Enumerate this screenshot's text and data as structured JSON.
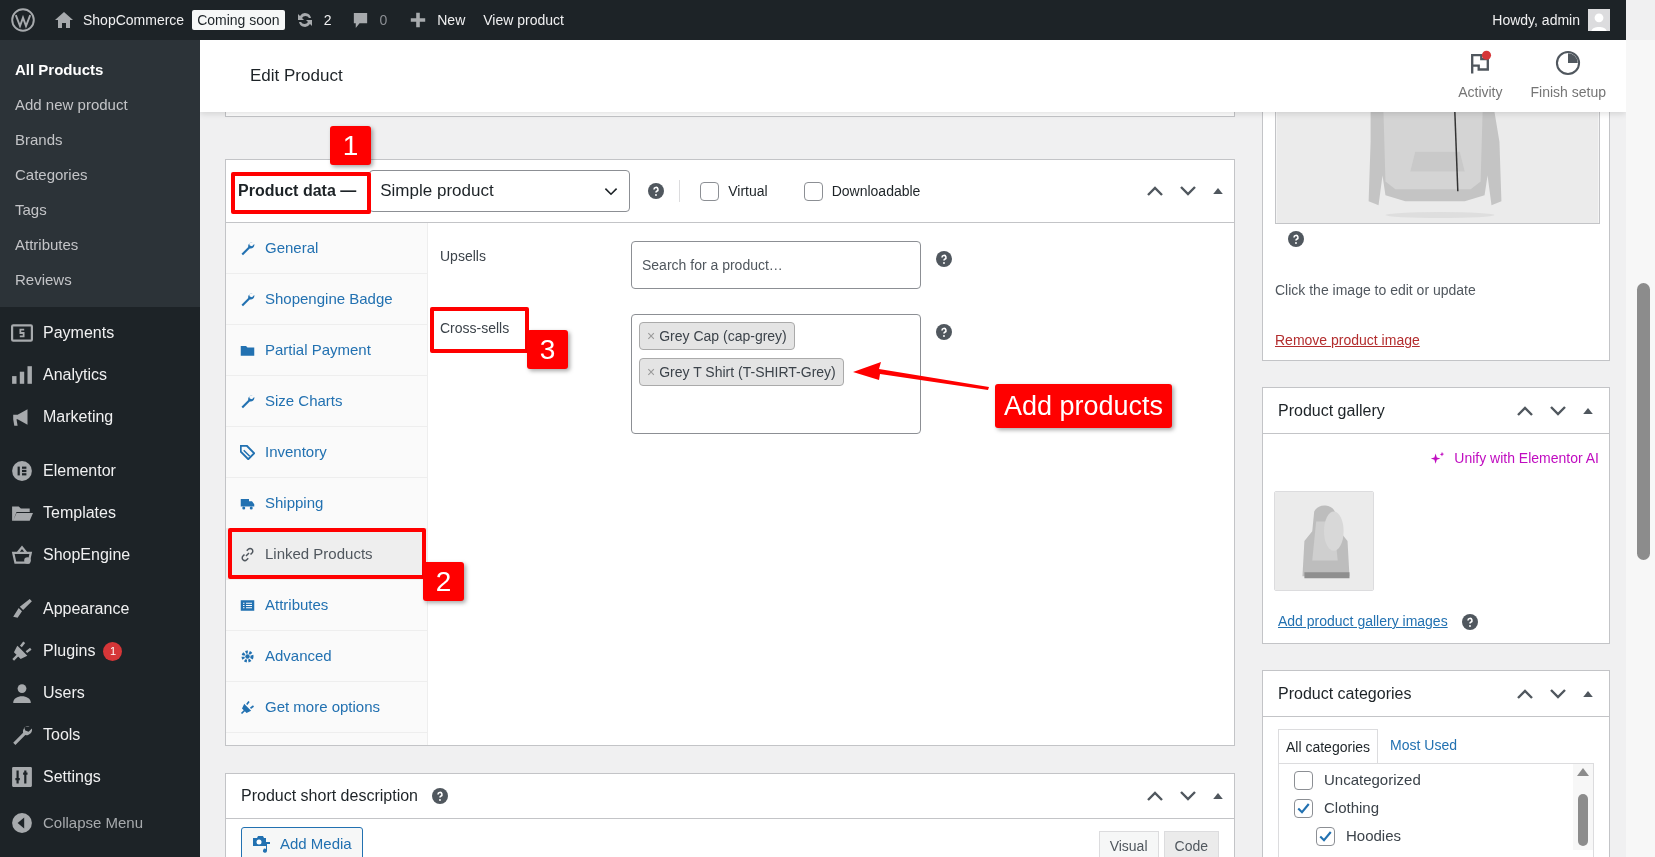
{
  "admin_bar": {
    "site_name": "ShopCommerce",
    "site_status": "Coming soon",
    "updates_count": "2",
    "comments_count": "0",
    "new_label": "New",
    "view_label": "View product",
    "greeting": "Howdy, admin"
  },
  "sidebar": {
    "submenu": [
      {
        "label": "All Products",
        "selected": true
      },
      {
        "label": "Add new product",
        "selected": false
      },
      {
        "label": "Brands",
        "selected": false
      },
      {
        "label": "Categories",
        "selected": false
      },
      {
        "label": "Tags",
        "selected": false
      },
      {
        "label": "Attributes",
        "selected": false
      },
      {
        "label": "Reviews",
        "selected": false
      }
    ],
    "menu_groups": [
      [
        {
          "label": "Payments"
        },
        {
          "label": "Analytics"
        },
        {
          "label": "Marketing"
        }
      ],
      [
        {
          "label": "Elementor"
        },
        {
          "label": "Templates"
        },
        {
          "label": "ShopEngine"
        }
      ],
      [
        {
          "label": "Appearance"
        },
        {
          "label": "Plugins",
          "badge": "1"
        },
        {
          "label": "Users"
        },
        {
          "label": "Tools"
        },
        {
          "label": "Settings"
        }
      ]
    ],
    "collapse_label": "Collapse Menu"
  },
  "header": {
    "title": "Edit Product",
    "actions": [
      {
        "label": "Activity",
        "notification": true
      },
      {
        "label": "Finish setup",
        "notification": false
      }
    ]
  },
  "product_data": {
    "title": "Product data —",
    "product_type": "Simple product",
    "options": [
      {
        "label": "Virtual",
        "checked": false
      },
      {
        "label": "Downloadable",
        "checked": false
      }
    ],
    "tabs": [
      {
        "label": "General",
        "selected": false
      },
      {
        "label": "Shopengine Badge",
        "selected": false
      },
      {
        "label": "Partial Payment",
        "selected": false
      },
      {
        "label": "Size Charts",
        "selected": false
      },
      {
        "label": "Inventory",
        "selected": false
      },
      {
        "label": "Shipping",
        "selected": false
      },
      {
        "label": "Linked Products",
        "selected": true
      },
      {
        "label": "Attributes",
        "selected": false
      },
      {
        "label": "Advanced",
        "selected": false
      },
      {
        "label": "Get more options",
        "selected": false
      }
    ],
    "upsells": {
      "label": "Upsells",
      "placeholder": "Search for a product…"
    },
    "cross_sells": {
      "label": "Cross-sells",
      "tags": [
        {
          "remove": "×",
          "label": "Grey Cap (cap-grey)"
        },
        {
          "remove": "×",
          "label": "Grey T Shirt (T-SHIRT-Grey)"
        }
      ]
    }
  },
  "annotations": {
    "markers": [
      "1",
      "2",
      "3"
    ],
    "callout": "Add products"
  },
  "product_image": {
    "hint": "Click the image to edit or update",
    "remove_link": "Remove product image"
  },
  "product_gallery": {
    "title": "Product gallery",
    "ai_link": "Unify with Elementor AI",
    "add_link": "Add product gallery images"
  },
  "product_categories": {
    "title": "Product categories",
    "tabs": [
      {
        "label": "All categories",
        "selected": true
      },
      {
        "label": "Most Used",
        "selected": false
      }
    ],
    "items": [
      {
        "label": "Uncategorized",
        "checked": false
      },
      {
        "label": "Clothing",
        "checked": true,
        "children": [
          {
            "label": "Hoodies",
            "checked": true
          }
        ]
      }
    ]
  },
  "short_description": {
    "title": "Product short description",
    "add_media": "Add Media",
    "editor_tabs": [
      {
        "label": "Visual",
        "selected": true
      },
      {
        "label": "Code",
        "selected": false
      }
    ]
  }
}
